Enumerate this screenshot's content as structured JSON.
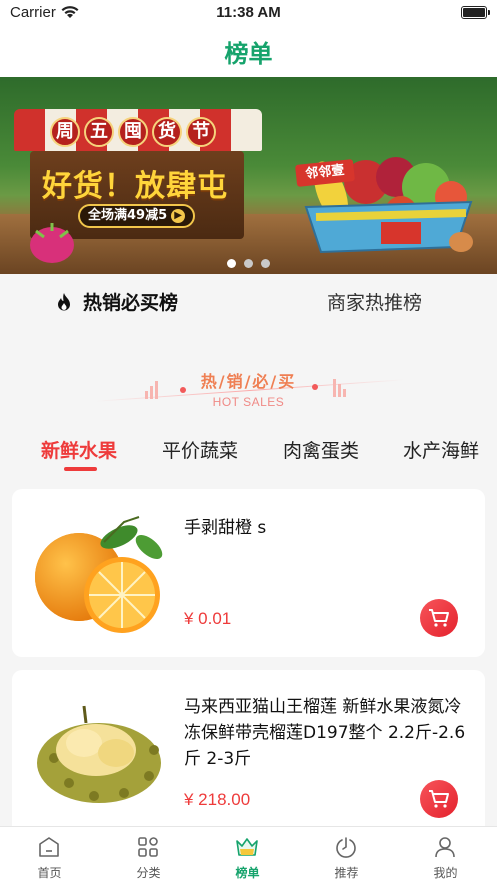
{
  "status_bar": {
    "carrier": "Carrier",
    "time": "11:38 AM"
  },
  "nav": {
    "title": "榜单"
  },
  "banner": {
    "festival_chars": [
      "周",
      "五",
      "囤",
      "货",
      "节"
    ],
    "headline": "好货！放肆屯",
    "promo": "全场满49减5",
    "shop_sign": "邻邻壹",
    "dots": 3,
    "active_dot": 0
  },
  "rank_tabs": [
    {
      "label": "热销必买榜",
      "active": true
    },
    {
      "label": "商家热推榜",
      "active": false
    }
  ],
  "section": {
    "title": "热/销/必/买",
    "subtitle": "HOT SALES"
  },
  "categories": [
    {
      "label": "新鲜水果",
      "active": true
    },
    {
      "label": "平价蔬菜",
      "active": false
    },
    {
      "label": "肉禽蛋类",
      "active": false
    },
    {
      "label": "水产海鲜",
      "active": false
    }
  ],
  "products": [
    {
      "name": "手剥甜橙 s",
      "price": "¥ 0.01",
      "image": "orange"
    },
    {
      "name": "马来西亚猫山王榴莲 新鲜水果液氮冷冻保鲜带壳榴莲D197整个 2.2斤-2.6斤 2-3斤",
      "price": "¥ 218.00",
      "image": "durian"
    }
  ],
  "tab_bar": [
    {
      "label": "首页",
      "icon": "home-icon",
      "active": false
    },
    {
      "label": "分类",
      "icon": "grid-icon",
      "active": false
    },
    {
      "label": "榜单",
      "icon": "crown-icon",
      "active": true
    },
    {
      "label": "推荐",
      "icon": "recommend-icon",
      "active": false
    },
    {
      "label": "我的",
      "icon": "user-icon",
      "active": false
    }
  ],
  "colors": {
    "brand_green": "#16a36c",
    "accent_red": "#ee3b3b"
  }
}
